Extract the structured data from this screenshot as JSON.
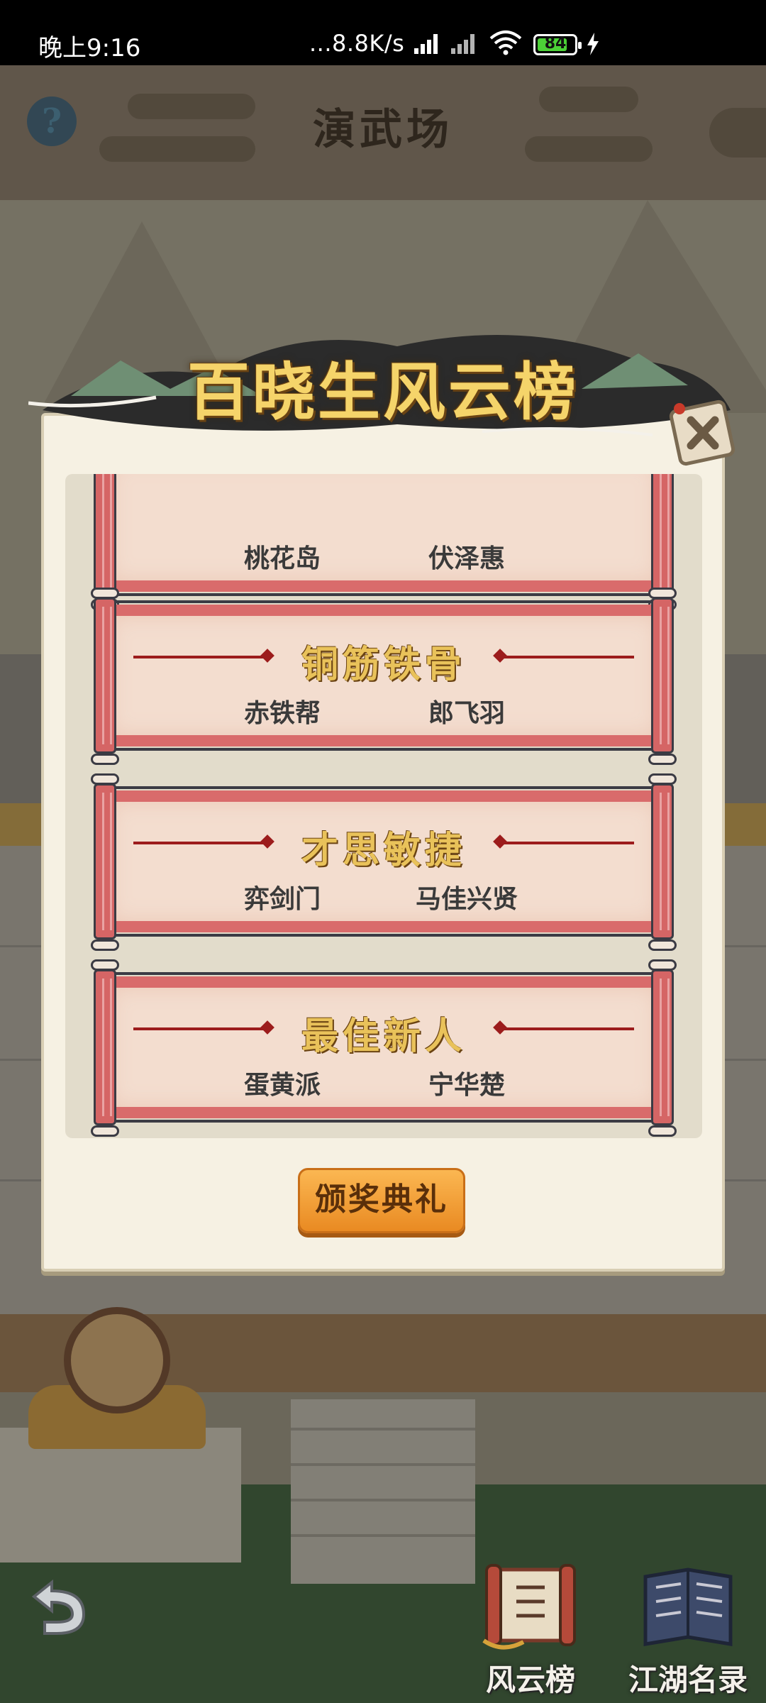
{
  "status_bar": {
    "time": "晚上9:16",
    "network_speed": "...8.8K/s",
    "battery": "84",
    "battery_level": 0.84
  },
  "scene": {
    "title": "演武场",
    "help_label": "?"
  },
  "modal": {
    "title": "百晓生风云榜",
    "awards": [
      {
        "award": "",
        "sect": "桃花岛",
        "winner": "伏泽惠"
      },
      {
        "award": "铜筋铁骨",
        "sect": "赤铁帮",
        "winner": "郎飞羽"
      },
      {
        "award": "才思敏捷",
        "sect": "弈剑门",
        "winner": "马佳兴贤"
      },
      {
        "award": "最佳新人",
        "sect": "蛋黄派",
        "winner": "宁华楚"
      }
    ],
    "button_label": "颁奖典礼"
  },
  "bottom_nav": {
    "items": [
      {
        "label": "风云榜",
        "icon": "scroll-icon"
      },
      {
        "label": "江湖名录",
        "icon": "book-icon"
      }
    ]
  },
  "colors": {
    "banner_text": "#f5d46a",
    "scroll_red": "#d96b6b",
    "button_orange": "#f3a13a"
  }
}
